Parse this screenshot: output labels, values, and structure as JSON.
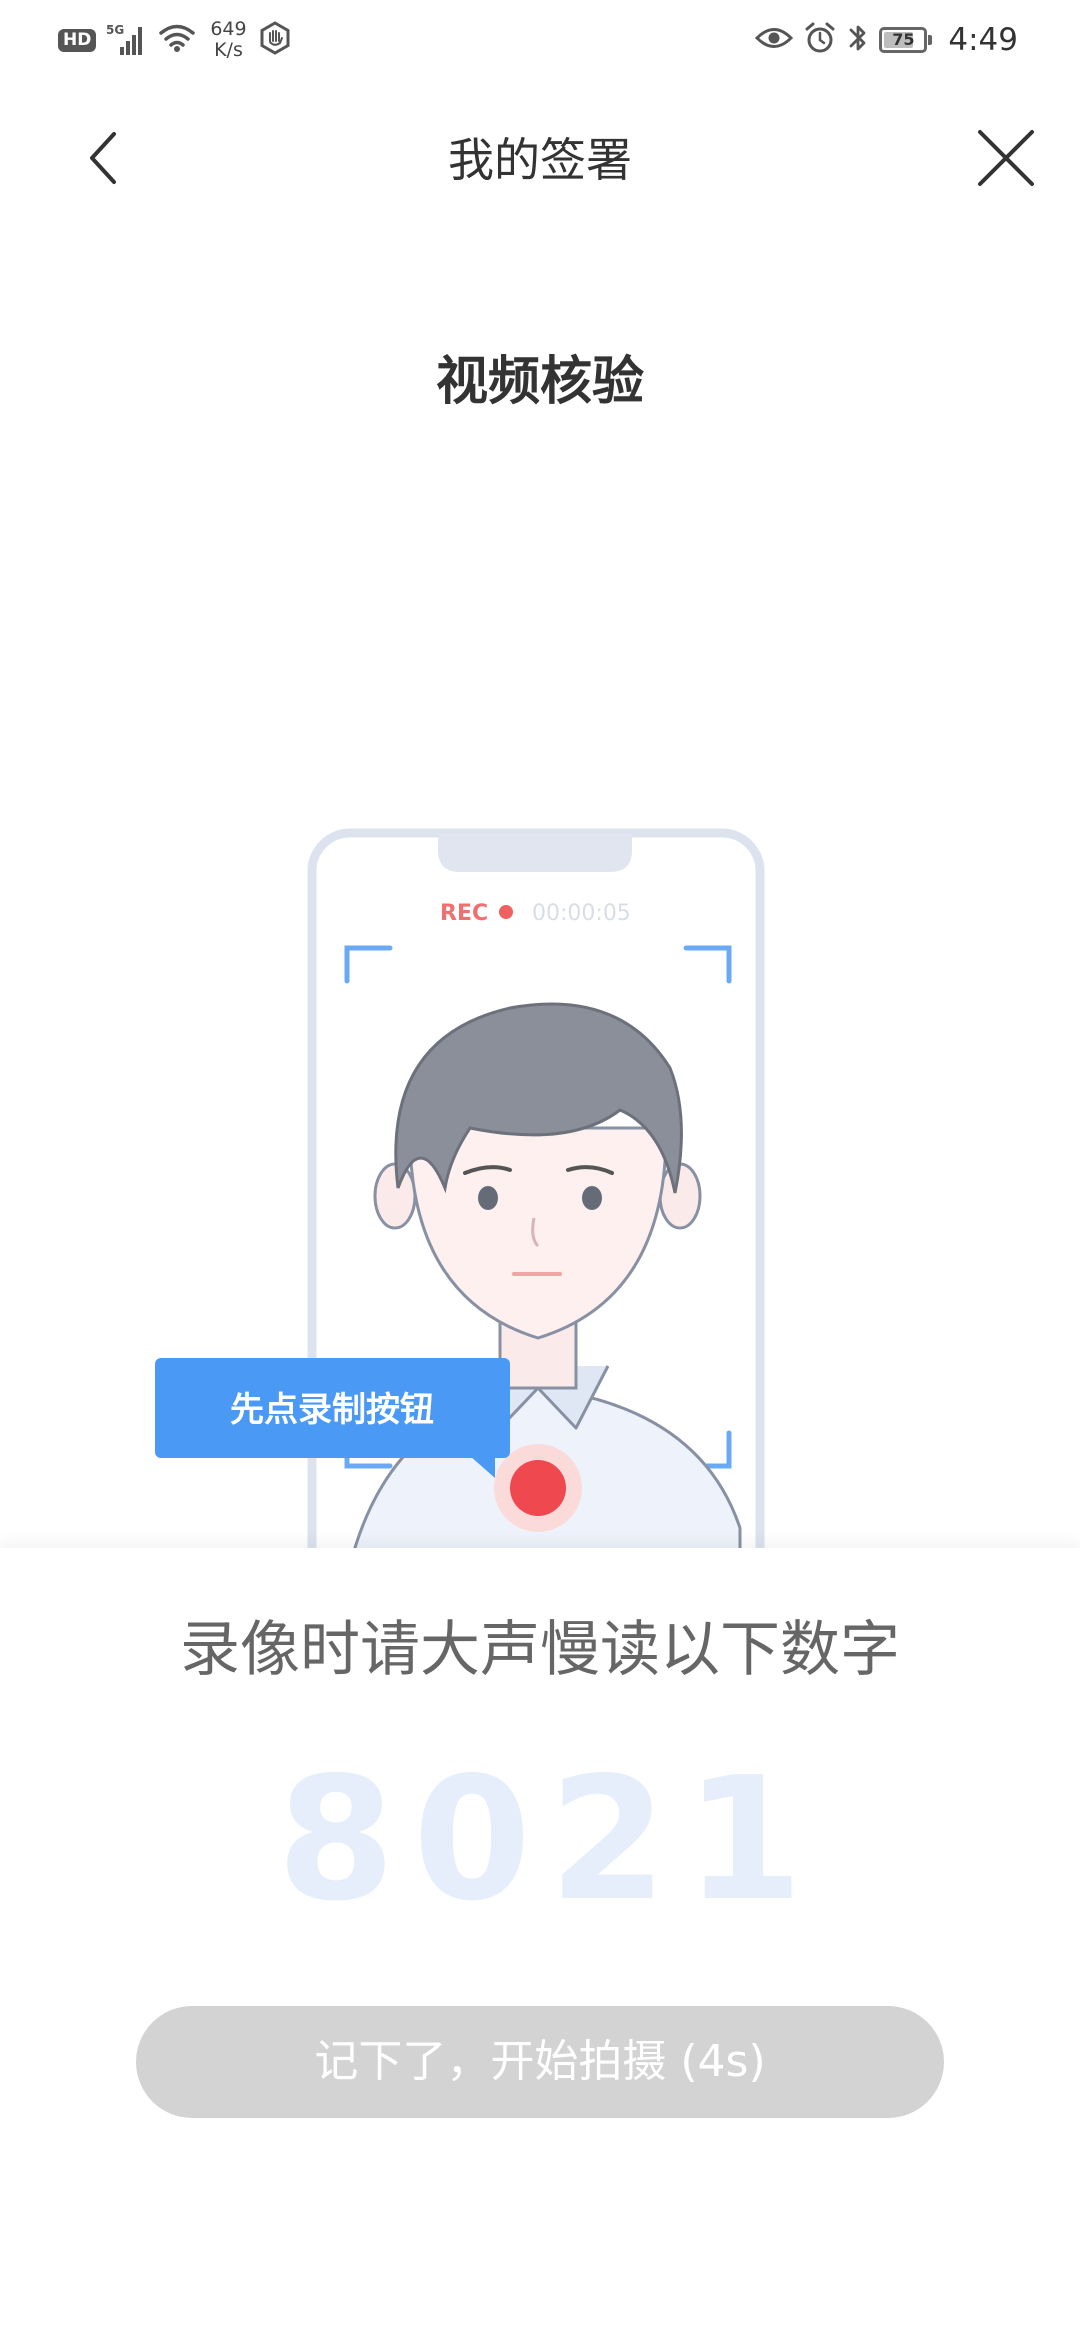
{
  "status_bar": {
    "hd": "HD",
    "signal_type": "5G",
    "net_speed_value": "649",
    "net_speed_unit": "K/s",
    "battery_level": 75,
    "battery_text": "75",
    "time": "4:49"
  },
  "nav": {
    "title": "我的签署",
    "back_icon": "chevron-left-icon",
    "close_icon": "close-icon"
  },
  "page": {
    "section_title": "视频核验",
    "instruction": "录像时请大声慢读以下数字",
    "digits": [
      "8",
      "0",
      "2",
      "1"
    ],
    "start_button_label": "记下了，开始拍摄 (4s)"
  },
  "illustration": {
    "rec_label": "REC",
    "rec_time": "00:00:05",
    "tooltip": "先点录制按钮"
  },
  "colors": {
    "accent_blue": "#4a9af5",
    "record_red": "#f0484f",
    "button_disabled": "#d3d3d3",
    "digit_faded": "#e6eefb"
  }
}
